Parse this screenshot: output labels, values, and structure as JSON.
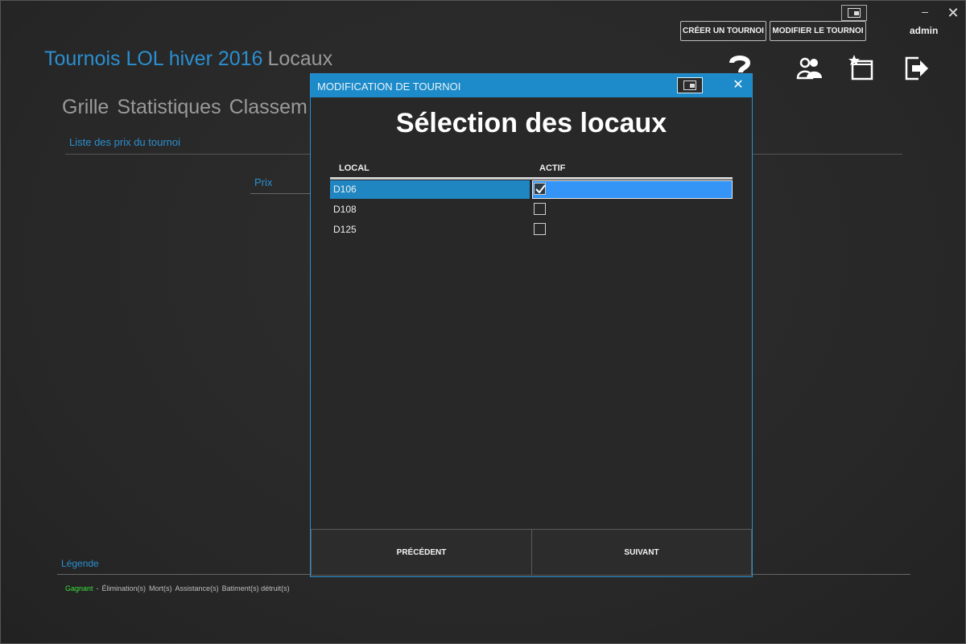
{
  "window": {
    "toggle_icon": "window-mode-icon",
    "minimize_label": "–",
    "close_label": "✕"
  },
  "header": {
    "create_button": "CRÉER UN TOURNOI",
    "edit_button": "MODIFIER LE TOURNOI",
    "user": "admin",
    "title": "Tournois LOL hiver 2016",
    "subtitle": "Locaux",
    "icons": [
      "help-icon",
      "users-icon",
      "favorite-window-icon",
      "logout-icon"
    ]
  },
  "nav": {
    "items": [
      "Grille",
      "Statistiques",
      "Classem"
    ]
  },
  "content": {
    "section_title": "Liste des prix du tournoi",
    "prix_label": "Prix"
  },
  "legend": {
    "title": "Légende",
    "gagnant": "Gagnant",
    "separator": "-",
    "items": [
      "Élimination(s)",
      "Mort(s)",
      "Assistance(s)",
      "Batiment(s) détruit(s)"
    ]
  },
  "modal": {
    "title": "MODIFICATION DE TOURNOI",
    "heading": "Sélection des locaux",
    "columns": {
      "local": "LOCAL",
      "actif": "ACTIF"
    },
    "rows": [
      {
        "local": "D106",
        "actif": true,
        "selected": true
      },
      {
        "local": "D108",
        "actif": false,
        "selected": false
      },
      {
        "local": "D125",
        "actif": false,
        "selected": false
      }
    ],
    "prev_button": "PRÉCÉDENT",
    "next_button": "SUIVANT",
    "close_label": "✕"
  },
  "colors": {
    "accent": "#2b8fd0",
    "selection": "#3495f7",
    "winner": "#3be03b"
  }
}
